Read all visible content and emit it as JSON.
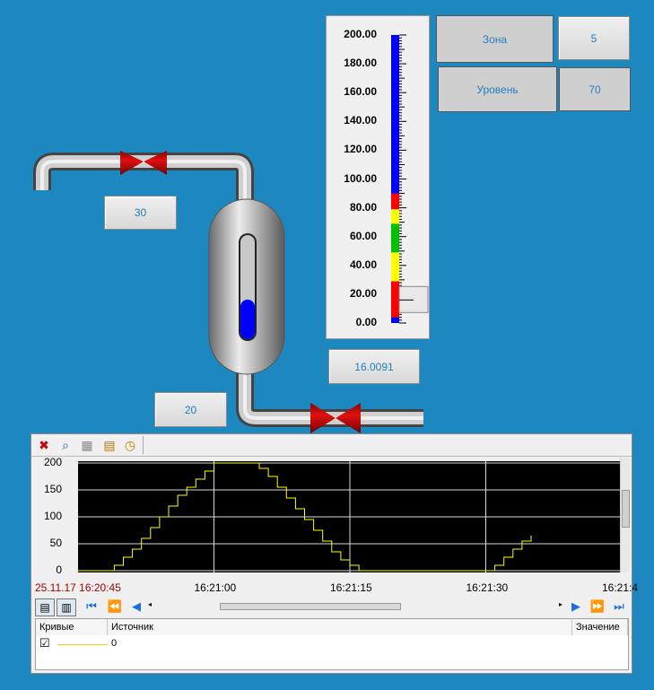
{
  "process": {
    "inlet_flow_value": "30",
    "tank_value": "20",
    "level_value": "16.0091",
    "tank_level_fraction": 0.38
  },
  "indicators": {
    "zone_label": "Зона",
    "zone_value": "5",
    "level_label": "Уровень",
    "level_value": "70"
  },
  "scale": {
    "labels": [
      "200.00",
      "180.00",
      "160.00",
      "140.00",
      "120.00",
      "100.00",
      "80.00",
      "60.00",
      "40.00",
      "20.00",
      "0.00"
    ],
    "min": 0,
    "max": 200,
    "pointer_value": 16.0091,
    "bands": [
      {
        "from": 0,
        "to": 4,
        "color": "#0000ff"
      },
      {
        "from": 4,
        "to": 29,
        "color": "#ff0000"
      },
      {
        "from": 29,
        "to": 49,
        "color": "#ffff00"
      },
      {
        "from": 49,
        "to": 69,
        "color": "#00c000"
      },
      {
        "from": 69,
        "to": 79,
        "color": "#ffff00"
      },
      {
        "from": 79,
        "to": 90,
        "color": "#ff0000"
      },
      {
        "from": 90,
        "to": 200,
        "color": "#0000ff"
      }
    ]
  },
  "trend": {
    "start_timestamp": "25.11.17 16:20:45",
    "x_labels": [
      "16:21:00",
      "16:21:15",
      "16:21:30",
      "16:21:4"
    ],
    "headers": {
      "curves": "Кривые",
      "source": "Источник",
      "value": "Значение"
    },
    "legend_rows": [
      {
        "checked": "☑",
        "name": "0"
      }
    ]
  },
  "chart_data": {
    "type": "line",
    "xlabel": "",
    "ylabel": "",
    "ylim": [
      0,
      200
    ],
    "xlim": [
      "16:20:45",
      "16:21:45"
    ],
    "x_ticks": [
      "16:21:00",
      "16:21:15",
      "16:21:30"
    ],
    "y_ticks": [
      0,
      50,
      100,
      150,
      200
    ],
    "line_color": "#ffff00",
    "background": "#000000",
    "series": [
      {
        "x": [
          "16:20:45",
          "16:20:48",
          "16:20:49",
          "16:20:50",
          "16:20:51",
          "16:20:52",
          "16:20:53",
          "16:20:54",
          "16:20:55",
          "16:20:56",
          "16:20:57",
          "16:20:58",
          "16:20:59",
          "16:21:00",
          "16:21:04",
          "16:21:05",
          "16:21:06",
          "16:21:07",
          "16:21:08",
          "16:21:09",
          "16:21:10",
          "16:21:11",
          "16:21:12",
          "16:21:13",
          "16:21:14",
          "16:21:15",
          "16:21:16",
          "16:21:17",
          "16:21:30",
          "16:21:31",
          "16:21:32",
          "16:21:33",
          "16:21:34",
          "16:21:35"
        ],
        "y": [
          0,
          0,
          10,
          25,
          40,
          60,
          80,
          100,
          120,
          140,
          155,
          170,
          185,
          200,
          200,
          190,
          175,
          155,
          135,
          115,
          95,
          75,
          55,
          35,
          20,
          10,
          0,
          0,
          0,
          10,
          25,
          40,
          55,
          65
        ]
      }
    ]
  }
}
